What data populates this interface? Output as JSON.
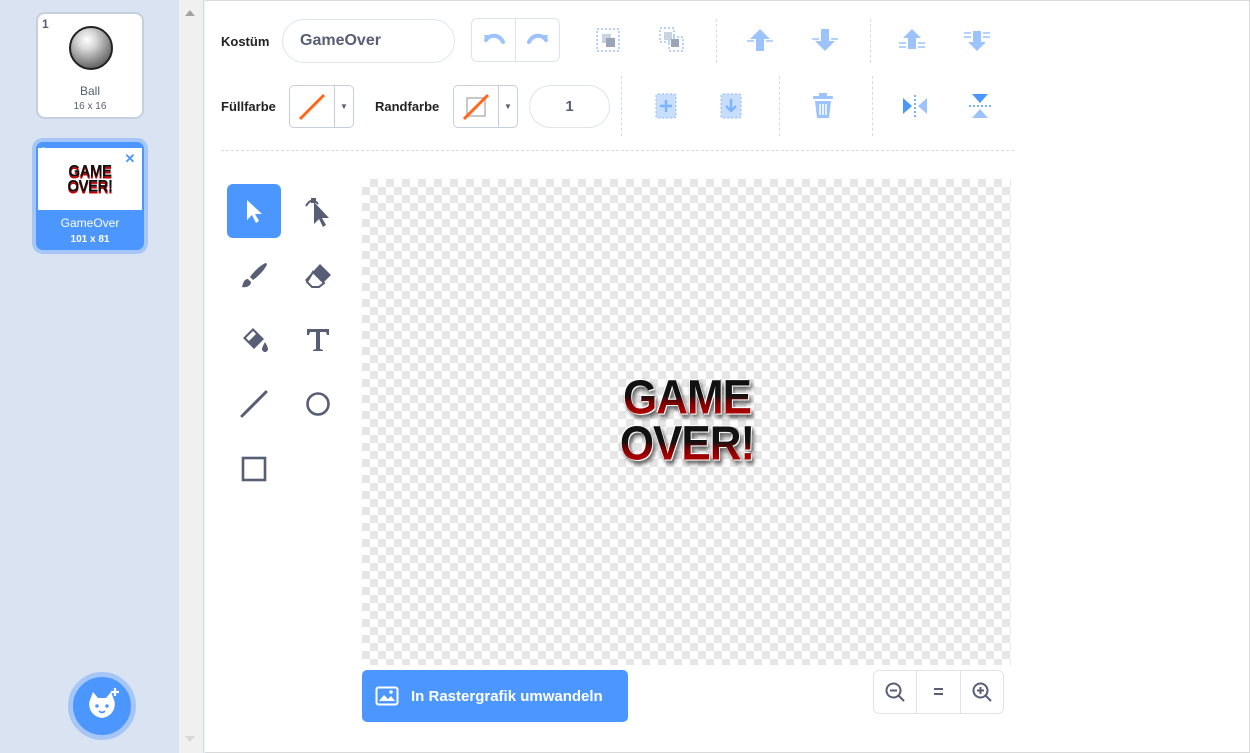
{
  "costumes": [
    {
      "number": "1",
      "name": "Ball",
      "size": "16 x 16",
      "selected": false
    },
    {
      "number": "2",
      "name": "GameOver",
      "size": "101 x 81",
      "selected": true,
      "thumb_text": [
        "GAME",
        "OVER!"
      ]
    }
  ],
  "toolbar": {
    "costume_label": "Kostüm",
    "costume_name": "GameOver",
    "fill_label": "Füllfarbe",
    "outline_label": "Randfarbe",
    "outline_width": "1"
  },
  "canvas": {
    "artwork_lines": [
      "GAME",
      "OVER!"
    ]
  },
  "convert_button_label": "In Rastergrafik umwandeln",
  "zoom": {
    "reset_label": "="
  },
  "colors": {
    "accent": "#4c97ff",
    "accent_light": "#a6c6f7",
    "icon": "#575e75",
    "disabled_icon": "#4c97ff"
  }
}
